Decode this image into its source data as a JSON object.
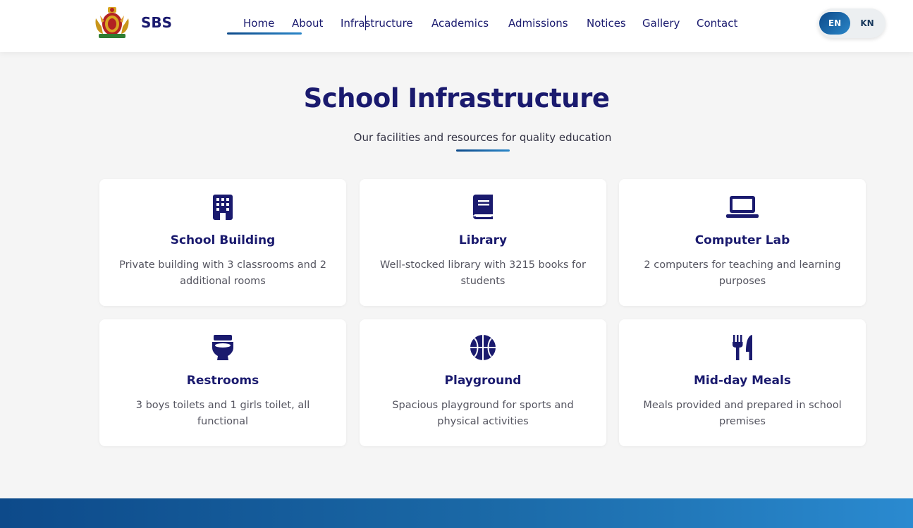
{
  "header": {
    "brand_name": "SBS",
    "emblem_icon": "karnataka-emblem-icon",
    "nav": [
      {
        "label": "Home",
        "active": true
      },
      {
        "label": "About"
      },
      {
        "label": "Infrastructure"
      },
      {
        "label": "Academics"
      },
      {
        "label": "Admissions"
      },
      {
        "label": "Notices"
      },
      {
        "label": "Gallery"
      },
      {
        "label": "Contact"
      }
    ],
    "languages": {
      "en": "EN",
      "kn": "KN",
      "selected": "EN"
    }
  },
  "main": {
    "title": "School Infrastructure",
    "subtitle": "Our facilities and resources for quality education",
    "cards": [
      {
        "icon": "building-icon",
        "title": "School Building",
        "description": "Private building with 3 classrooms and 2 additional rooms"
      },
      {
        "icon": "book-icon",
        "title": "Library",
        "description": "Well-stocked library with 3215 books for students"
      },
      {
        "icon": "laptop-icon",
        "title": "Computer Lab",
        "description": "2 computers for teaching and learning purposes"
      },
      {
        "icon": "toilet-icon",
        "title": "Restrooms",
        "description": "3 boys toilets and 1 girls toilet, all functional"
      },
      {
        "icon": "basketball-icon",
        "title": "Playground",
        "description": "Spacious playground for sports and physical activities"
      },
      {
        "icon": "utensils-icon",
        "title": "Mid-day Meals",
        "description": "Meals provided and prepared in school premises"
      }
    ]
  },
  "colors": {
    "primary": "#1a1a6e",
    "accent_start": "#0d4a8a",
    "accent_end": "#2a86c8",
    "background": "#f5f5f5"
  }
}
